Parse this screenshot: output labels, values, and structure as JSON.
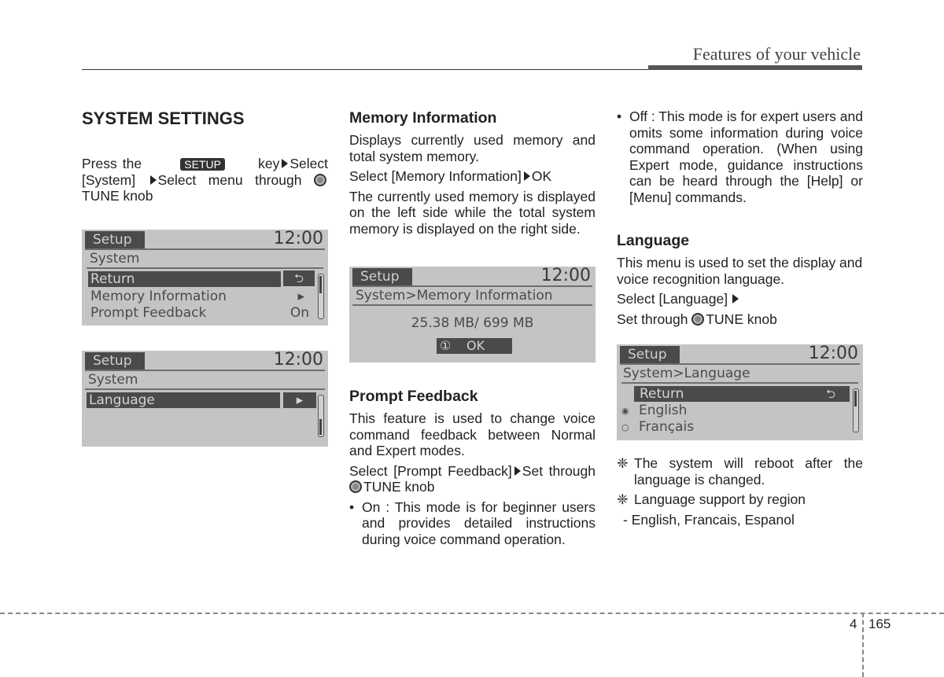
{
  "header": {
    "title": "Features of your vehicle"
  },
  "col1": {
    "heading": "SYSTEM SETTINGS",
    "intro": {
      "press": "Press the",
      "key": "SETUP",
      "key_select": "key",
      "select1": "Select",
      "system": "[System]",
      "select_menu": "Select menu through",
      "tune": "TUNE knob"
    }
  },
  "screen1": {
    "tab": "Setup",
    "clock": "12:00",
    "subtitle": "System",
    "items": [
      {
        "label": "Return",
        "value": "⮌",
        "selected": true
      },
      {
        "label": "Memory Information",
        "value": "▸",
        "selected": false
      },
      {
        "label": "Prompt Feedback",
        "value": "On",
        "selected": false
      }
    ]
  },
  "screen2": {
    "tab": "Setup",
    "clock": "12:00",
    "subtitle": "System",
    "items": [
      {
        "label": "Language",
        "value": "▸",
        "selected": true
      }
    ]
  },
  "col2": {
    "memory": {
      "heading": "Memory Information",
      "p1": "Displays currently used memory and total system memory.",
      "p2_pre": "Select [Memory Information]",
      "p2_post": "OK",
      "p3": "The currently used memory is displayed on the left side while the total system memory is displayed on the right side."
    },
    "prompt": {
      "heading": "Prompt Feedback",
      "p1": "This feature is used to change voice command feedback between Normal and Expert modes.",
      "p2_pre": "Select [Prompt Feedback]",
      "p2_post": "Set through",
      "tune": "TUNE knob",
      "bullet_on": "On : This mode is for beginner users and provides detailed instructions during voice command operation."
    }
  },
  "screen3": {
    "tab": "Setup",
    "clock": "12:00",
    "breadcrumb": "System>Memory Information",
    "memory_value": "25.38 MB/ 699 MB",
    "ok_icon": "①",
    "ok_label": "OK"
  },
  "col3": {
    "bullet_off": "Off : This mode is for expert users and omits some information during voice command operation. (When using Expert mode, guidance instructions can be heard through the [Help] or [Menu] commands.",
    "language": {
      "heading": "Language",
      "p1": "This menu is used to set the display and voice recognition language.",
      "p2": "Select [Language]",
      "p3_pre": "Set through",
      "tune": "TUNE knob"
    },
    "notes": [
      "The system will reboot after the language is changed.",
      "Language support by region"
    ],
    "note_mark": "❈",
    "regions": "- English, Francais, Espanol"
  },
  "screen4": {
    "tab": "Setup",
    "clock": "12:00",
    "breadcrumb": "System>Language",
    "return_label": "Return",
    "return_icon": "⮌",
    "options": [
      {
        "label": "English",
        "checked": true,
        "mark": "◉"
      },
      {
        "label": "Français",
        "checked": false,
        "mark": "○"
      }
    ]
  },
  "footer": {
    "section": "4",
    "page": "165"
  }
}
